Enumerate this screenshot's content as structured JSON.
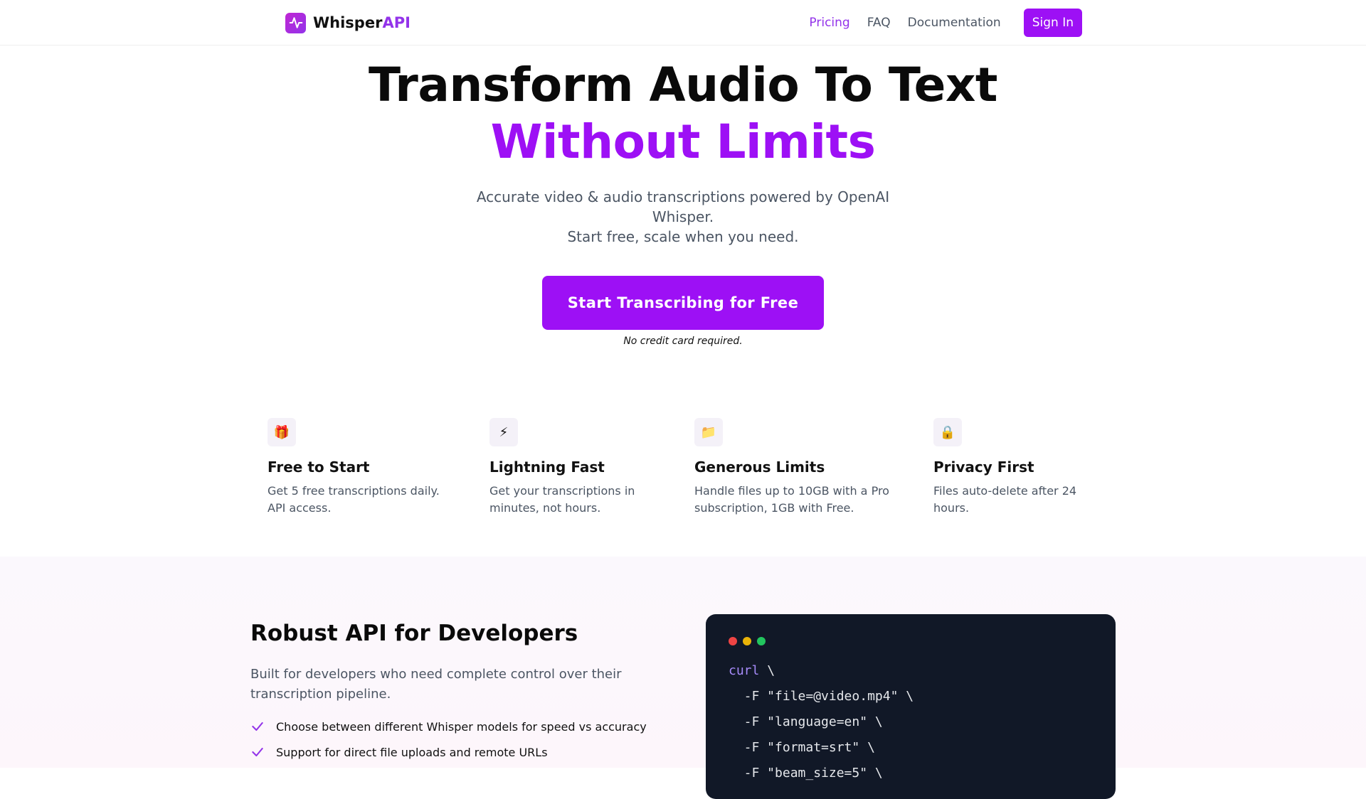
{
  "nav": {
    "logo_prefix": "Whisper",
    "logo_accent": "API",
    "links": [
      {
        "label": "Pricing"
      },
      {
        "label": "FAQ"
      },
      {
        "label": "Documentation"
      }
    ],
    "signin_label": "Sign In"
  },
  "hero": {
    "title_line1": "Transform Audio To Text",
    "title_line2": "Without Limits",
    "subtitle_line1": "Accurate video & audio transcriptions powered by OpenAI Whisper.",
    "subtitle_line2": "Start free, scale when you need.",
    "cta_label": "Start Transcribing for Free",
    "cta_note": "No credit card required."
  },
  "features": [
    {
      "icon": "gift-icon",
      "glyph": "🎁",
      "title": "Free to Start",
      "desc": "Get 5 free transcriptions daily. API access."
    },
    {
      "icon": "lightning-icon",
      "glyph": "⚡",
      "title": "Lightning Fast",
      "desc": "Get your transcriptions in minutes, not hours."
    },
    {
      "icon": "folder-icon",
      "glyph": "📁",
      "title": "Generous Limits",
      "desc": "Handle files up to 10GB with a Pro subscription, 1GB with Free."
    },
    {
      "icon": "lock-icon",
      "glyph": "🔒",
      "title": "Privacy First",
      "desc": "Files auto-delete after 24 hours."
    }
  ],
  "dev": {
    "title": "Robust API for Developers",
    "desc": "Built for developers who need complete control over their transcription pipeline.",
    "items": [
      "Choose between different Whisper models for speed vs accuracy",
      "Support for direct file uploads and remote URLs"
    ],
    "code": {
      "cmd": "curl",
      "line1_rest": " \\",
      "lines": [
        "  -F \"file=@video.mp4\" \\",
        "  -F \"language=en\" \\",
        "  -F \"format=srt\" \\",
        "  -F \"beam_size=5\" \\"
      ]
    }
  },
  "colors": {
    "brand": "#9d10f5",
    "dot_red": "#ef4444",
    "dot_yellow": "#eab308",
    "dot_green": "#22c55e",
    "code_bg": "#111827"
  }
}
